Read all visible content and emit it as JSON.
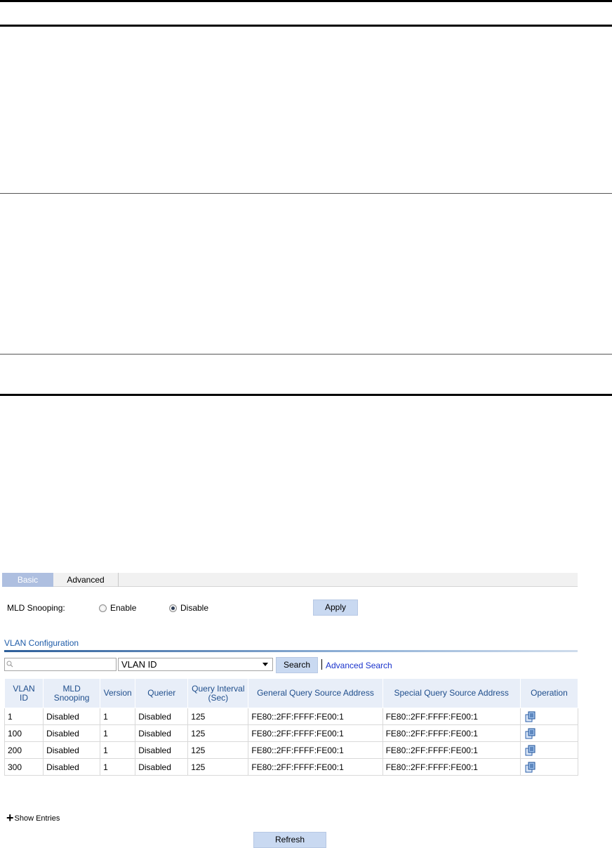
{
  "tabs": [
    {
      "label": "Basic",
      "active": true
    },
    {
      "label": "Advanced",
      "active": false
    }
  ],
  "snooping": {
    "label": "MLD Snooping:",
    "options": [
      {
        "label": "Enable",
        "checked": false
      },
      {
        "label": "Disable",
        "checked": true
      }
    ],
    "apply_label": "Apply"
  },
  "vlan_section": {
    "title": "VLAN Configuration",
    "search_placeholder": "",
    "search_field_value": "VLAN ID",
    "search_button": "Search",
    "advanced_search": "Advanced Search"
  },
  "table": {
    "headers": [
      "VLAN ID",
      "MLD Snooping",
      "Version",
      "Querier",
      "Query Interval (Sec)",
      "General Query Source Address",
      "Special Query Source Address",
      "Operation"
    ],
    "rows": [
      {
        "vlan_id": "1",
        "mld_snooping": "Disabled",
        "version": "1",
        "querier": "Disabled",
        "interval": "125",
        "general_addr": "FE80::2FF:FFFF:FE00:1",
        "special_addr": "FE80::2FF:FFFF:FE00:1",
        "operation_icon": "edit-icon"
      },
      {
        "vlan_id": "100",
        "mld_snooping": "Disabled",
        "version": "1",
        "querier": "Disabled",
        "interval": "125",
        "general_addr": "FE80::2FF:FFFF:FE00:1",
        "special_addr": "FE80::2FF:FFFF:FE00:1",
        "operation_icon": "edit-icon"
      },
      {
        "vlan_id": "200",
        "mld_snooping": "Disabled",
        "version": "1",
        "querier": "Disabled",
        "interval": "125",
        "general_addr": "FE80::2FF:FFFF:FE00:1",
        "special_addr": "FE80::2FF:FFFF:FE00:1",
        "operation_icon": "edit-icon"
      },
      {
        "vlan_id": "300",
        "mld_snooping": "Disabled",
        "version": "1",
        "querier": "Disabled",
        "interval": "125",
        "general_addr": "FE80::2FF:FFFF:FE00:1",
        "special_addr": "FE80::2FF:FFFF:FE00:1",
        "operation_icon": "edit-icon"
      }
    ]
  },
  "show_entries": "Show Entries",
  "refresh_label": "Refresh",
  "colors": {
    "tab_active": "#aebfe0",
    "header_bg": "#e8eef8",
    "header_text": "#1f4e8c",
    "button_bg": "#c9d9f1",
    "link": "#1a33cc"
  }
}
